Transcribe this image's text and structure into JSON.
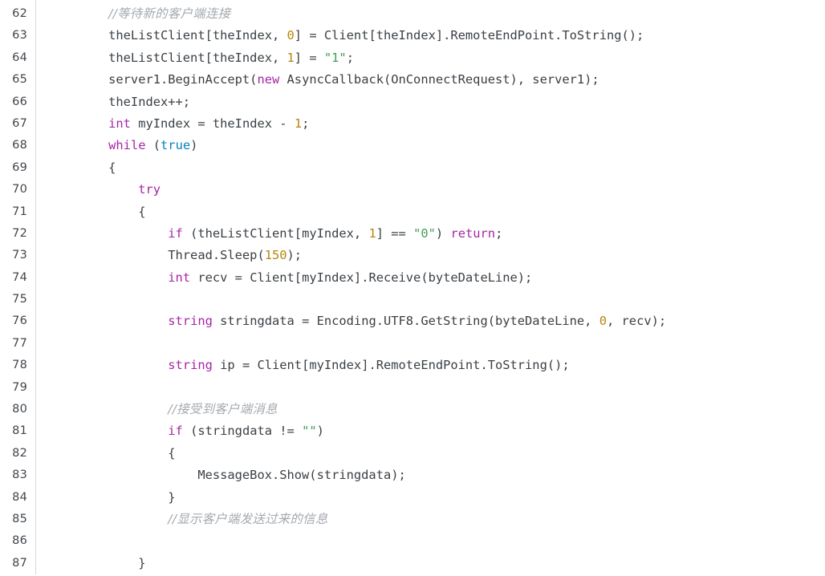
{
  "editor": {
    "name": "code-listing",
    "language": "C#",
    "first_line_number": 62,
    "last_line_number": 87,
    "background_color": "#ffffff",
    "gutter_divider_color": "#d7d7d7",
    "colors": {
      "plain": "#3b4045",
      "keyword": "#a626a4",
      "type": "#a626a4",
      "literal": "#0184bc",
      "string": "#3f9e55",
      "number": "#b8860b",
      "comment": "#a4a9ae",
      "line_number": "#40464c"
    }
  },
  "lines": [
    {
      "number": "62",
      "tokens": [
        {
          "t": "plain",
          "s": "        "
        },
        {
          "t": "comment",
          "s": "//等待新的客户端连接"
        }
      ]
    },
    {
      "number": "63",
      "tokens": [
        {
          "t": "plain",
          "s": "        theListClient[theIndex, "
        },
        {
          "t": "number",
          "s": "0"
        },
        {
          "t": "plain",
          "s": "] = Client[theIndex].RemoteEndPoint.ToString();"
        }
      ]
    },
    {
      "number": "64",
      "tokens": [
        {
          "t": "plain",
          "s": "        theListClient[theIndex, "
        },
        {
          "t": "number",
          "s": "1"
        },
        {
          "t": "plain",
          "s": "] = "
        },
        {
          "t": "string",
          "s": "\"1\""
        },
        {
          "t": "plain",
          "s": ";"
        }
      ]
    },
    {
      "number": "65",
      "tokens": [
        {
          "t": "plain",
          "s": "        server1.BeginAccept("
        },
        {
          "t": "keyword",
          "s": "new"
        },
        {
          "t": "plain",
          "s": " AsyncCallback(OnConnectRequest), server1);"
        }
      ]
    },
    {
      "number": "66",
      "tokens": [
        {
          "t": "plain",
          "s": "        theIndex++;"
        }
      ]
    },
    {
      "number": "67",
      "tokens": [
        {
          "t": "plain",
          "s": "        "
        },
        {
          "t": "type",
          "s": "int"
        },
        {
          "t": "plain",
          "s": " myIndex = theIndex - "
        },
        {
          "t": "number",
          "s": "1"
        },
        {
          "t": "plain",
          "s": ";"
        }
      ]
    },
    {
      "number": "68",
      "tokens": [
        {
          "t": "plain",
          "s": "        "
        },
        {
          "t": "keyword",
          "s": "while"
        },
        {
          "t": "plain",
          "s": " ("
        },
        {
          "t": "literal",
          "s": "true"
        },
        {
          "t": "plain",
          "s": ")"
        }
      ]
    },
    {
      "number": "69",
      "tokens": [
        {
          "t": "plain",
          "s": "        {"
        }
      ]
    },
    {
      "number": "70",
      "tokens": [
        {
          "t": "plain",
          "s": "            "
        },
        {
          "t": "keyword",
          "s": "try"
        }
      ]
    },
    {
      "number": "71",
      "tokens": [
        {
          "t": "plain",
          "s": "            {"
        }
      ]
    },
    {
      "number": "72",
      "tokens": [
        {
          "t": "plain",
          "s": "                "
        },
        {
          "t": "keyword",
          "s": "if"
        },
        {
          "t": "plain",
          "s": " (theListClient[myIndex, "
        },
        {
          "t": "number",
          "s": "1"
        },
        {
          "t": "plain",
          "s": "] == "
        },
        {
          "t": "string",
          "s": "\"0\""
        },
        {
          "t": "plain",
          "s": ") "
        },
        {
          "t": "keyword",
          "s": "return"
        },
        {
          "t": "plain",
          "s": ";"
        }
      ]
    },
    {
      "number": "73",
      "tokens": [
        {
          "t": "plain",
          "s": "                Thread.Sleep("
        },
        {
          "t": "number",
          "s": "150"
        },
        {
          "t": "plain",
          "s": ");"
        }
      ]
    },
    {
      "number": "74",
      "tokens": [
        {
          "t": "plain",
          "s": "                "
        },
        {
          "t": "type",
          "s": "int"
        },
        {
          "t": "plain",
          "s": " recv = Client[myIndex].Receive(byteDateLine);"
        }
      ]
    },
    {
      "number": "75",
      "tokens": [
        {
          "t": "plain",
          "s": ""
        }
      ]
    },
    {
      "number": "76",
      "tokens": [
        {
          "t": "plain",
          "s": "                "
        },
        {
          "t": "type",
          "s": "string"
        },
        {
          "t": "plain",
          "s": " stringdata = Encoding.UTF8.GetString(byteDateLine, "
        },
        {
          "t": "number",
          "s": "0"
        },
        {
          "t": "plain",
          "s": ", recv);"
        }
      ]
    },
    {
      "number": "77",
      "tokens": [
        {
          "t": "plain",
          "s": ""
        }
      ]
    },
    {
      "number": "78",
      "tokens": [
        {
          "t": "plain",
          "s": "                "
        },
        {
          "t": "type",
          "s": "string"
        },
        {
          "t": "plain",
          "s": " ip = Client[myIndex].RemoteEndPoint.ToString();"
        }
      ]
    },
    {
      "number": "79",
      "tokens": [
        {
          "t": "plain",
          "s": ""
        }
      ]
    },
    {
      "number": "80",
      "tokens": [
        {
          "t": "plain",
          "s": "                "
        },
        {
          "t": "comment",
          "s": "//接受到客户端消息"
        }
      ]
    },
    {
      "number": "81",
      "tokens": [
        {
          "t": "plain",
          "s": "                "
        },
        {
          "t": "keyword",
          "s": "if"
        },
        {
          "t": "plain",
          "s": " (stringdata != "
        },
        {
          "t": "string",
          "s": "\"\""
        },
        {
          "t": "plain",
          "s": ")"
        }
      ]
    },
    {
      "number": "82",
      "tokens": [
        {
          "t": "plain",
          "s": "                {"
        }
      ]
    },
    {
      "number": "83",
      "tokens": [
        {
          "t": "plain",
          "s": "                    MessageBox.Show(stringdata);"
        }
      ]
    },
    {
      "number": "84",
      "tokens": [
        {
          "t": "plain",
          "s": "                }"
        }
      ]
    },
    {
      "number": "85",
      "tokens": [
        {
          "t": "plain",
          "s": "                "
        },
        {
          "t": "comment",
          "s": "//显示客户端发送过来的信息"
        }
      ]
    },
    {
      "number": "86",
      "tokens": [
        {
          "t": "plain",
          "s": ""
        }
      ]
    },
    {
      "number": "87",
      "tokens": [
        {
          "t": "plain",
          "s": "            }"
        }
      ]
    }
  ]
}
